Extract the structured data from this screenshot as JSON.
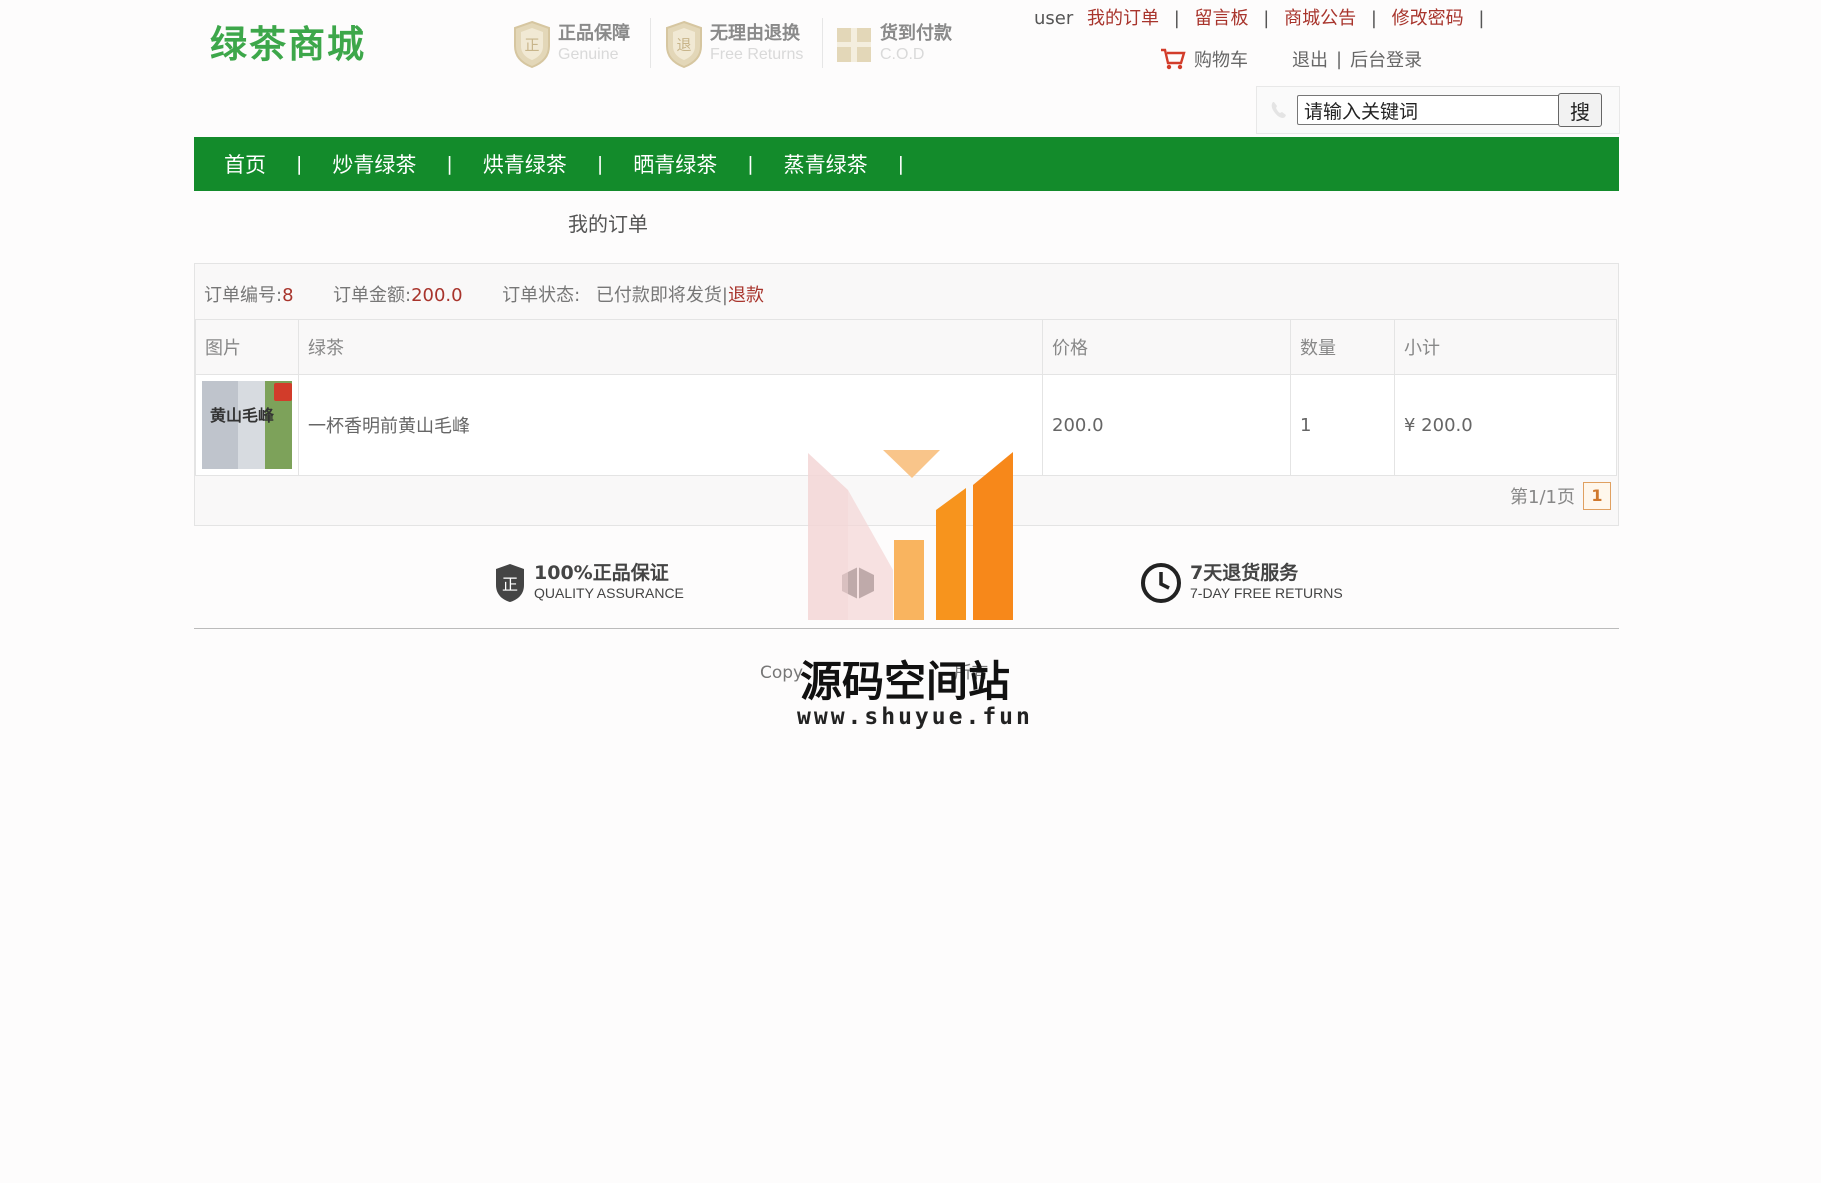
{
  "header": {
    "logo": "绿茶商城",
    "badges": [
      {
        "title": "正品保障",
        "subtitle": "Genuine",
        "icon": "shield-zheng-icon"
      },
      {
        "title": "无理由退换",
        "subtitle": "Free Returns",
        "icon": "shield-tui-icon"
      },
      {
        "title": "货到付款",
        "subtitle": "C.O.D",
        "icon": "gift-box-icon"
      }
    ],
    "top_links": {
      "user": "user",
      "my_orders": "我的订单",
      "message_board": "留言板",
      "announcements": "商城公告",
      "change_password": "修改密码",
      "separator": "|"
    },
    "cart_label": "购物车",
    "logout": "退出",
    "admin_login": "后台登录",
    "search": {
      "placeholder": "请输入关键词",
      "button": "搜"
    }
  },
  "nav": {
    "items": [
      "首页",
      "炒青绿茶",
      "烘青绿茶",
      "晒青绿茶",
      "蒸青绿茶"
    ],
    "separator": "|"
  },
  "page_title": "我的订单",
  "order": {
    "number_label": "订单编号:",
    "number": "8",
    "amount_label": "订单金额:",
    "amount": "200.0",
    "status_label": "订单状态:",
    "status": "已付款即将发货|",
    "refund_link": "退款",
    "columns": [
      "图片",
      "绿茶",
      "价格",
      "数量",
      "小计"
    ],
    "items": [
      {
        "image_text": "黄山毛峰",
        "name": "一杯香明前黄山毛峰",
        "price": "200.0",
        "qty": "1",
        "subtotal": "¥ 200.0"
      }
    ],
    "pager_text": "第1/1页",
    "current_page": "1"
  },
  "footer": {
    "features": [
      {
        "title": "100%正品保证",
        "subtitle": "QUALITY ASSURANCE",
        "icon": "shield-zheng-icon"
      },
      {
        "title": "",
        "subtitle": "",
        "icon": "box-icon"
      },
      {
        "title": "7天退货服务",
        "subtitle": "7-DAY FREE RETURNS",
        "icon": "clock-icon"
      }
    ],
    "copyright": "Copy                            所有"
  },
  "watermark": {
    "title": "源码空间站",
    "url": "www.shuyue.fun"
  },
  "colors": {
    "brand_green": "#138b2b",
    "logo_green": "#3da74a",
    "link_red": "#a8342c",
    "watermark_orange": "#f7941d"
  }
}
